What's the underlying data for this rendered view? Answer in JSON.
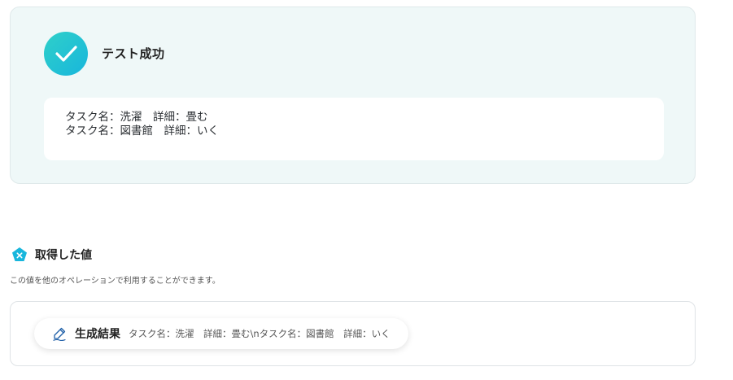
{
  "test_result": {
    "title": "テスト成功",
    "lines": [
      "タスク名：洗濯　詳細：畳む",
      "タスク名：図書館　詳細：いく"
    ]
  },
  "acquired": {
    "title": "取得した値",
    "description": "この値を他のオペレーションで利用することができます。",
    "items": [
      {
        "label": "生成結果",
        "value": "タスク名：洗濯　詳細：畳む\\nタスク名：図書館　詳細：いく"
      }
    ]
  },
  "colors": {
    "accent_gradient_start": "#2fd0c9",
    "accent_gradient_end": "#18b6dc",
    "success_card_bg": "#eff8f8",
    "section_icon": "#18b6dc"
  },
  "icons": {
    "success": "check-icon",
    "section": "pentagon-x-icon",
    "chip": "pen-icon"
  }
}
